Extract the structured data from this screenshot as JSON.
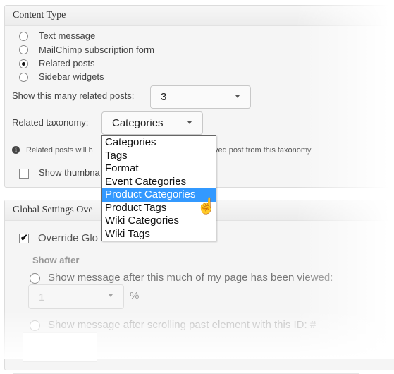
{
  "content_type": {
    "title": "Content Type",
    "options": [
      {
        "label": "Text message",
        "checked": false
      },
      {
        "label": "MailChimp subscription form",
        "checked": false
      },
      {
        "label": "Related posts",
        "checked": true
      },
      {
        "label": "Sidebar widgets",
        "checked": false
      }
    ],
    "related_count": {
      "label": "Show this many related posts:",
      "value": "3"
    },
    "taxonomy": {
      "label": "Related taxonomy:",
      "value": "Categories",
      "options": [
        "Categories",
        "Tags",
        "Format",
        "Event Categories",
        "Product Categories",
        "Product Tags",
        "Wiki Categories",
        "Wiki Tags"
      ],
      "highlighted": "Product Categories"
    },
    "info_text_left": "Related posts will h",
    "info_text_right": "yed post from this taxonomy",
    "show_thumbnails_label": "Show thumbna"
  },
  "global_settings": {
    "title": "Global Settings Ove",
    "override_label": "Override Glo",
    "override_checked": true,
    "show_after": {
      "legend": "Show after",
      "viewed_label": "Show message after this much of my page has been viewed:",
      "percent_value": "1",
      "percent_unit": "%",
      "scroll_label": "Show message after scrolling past element with this ID: #"
    }
  }
}
